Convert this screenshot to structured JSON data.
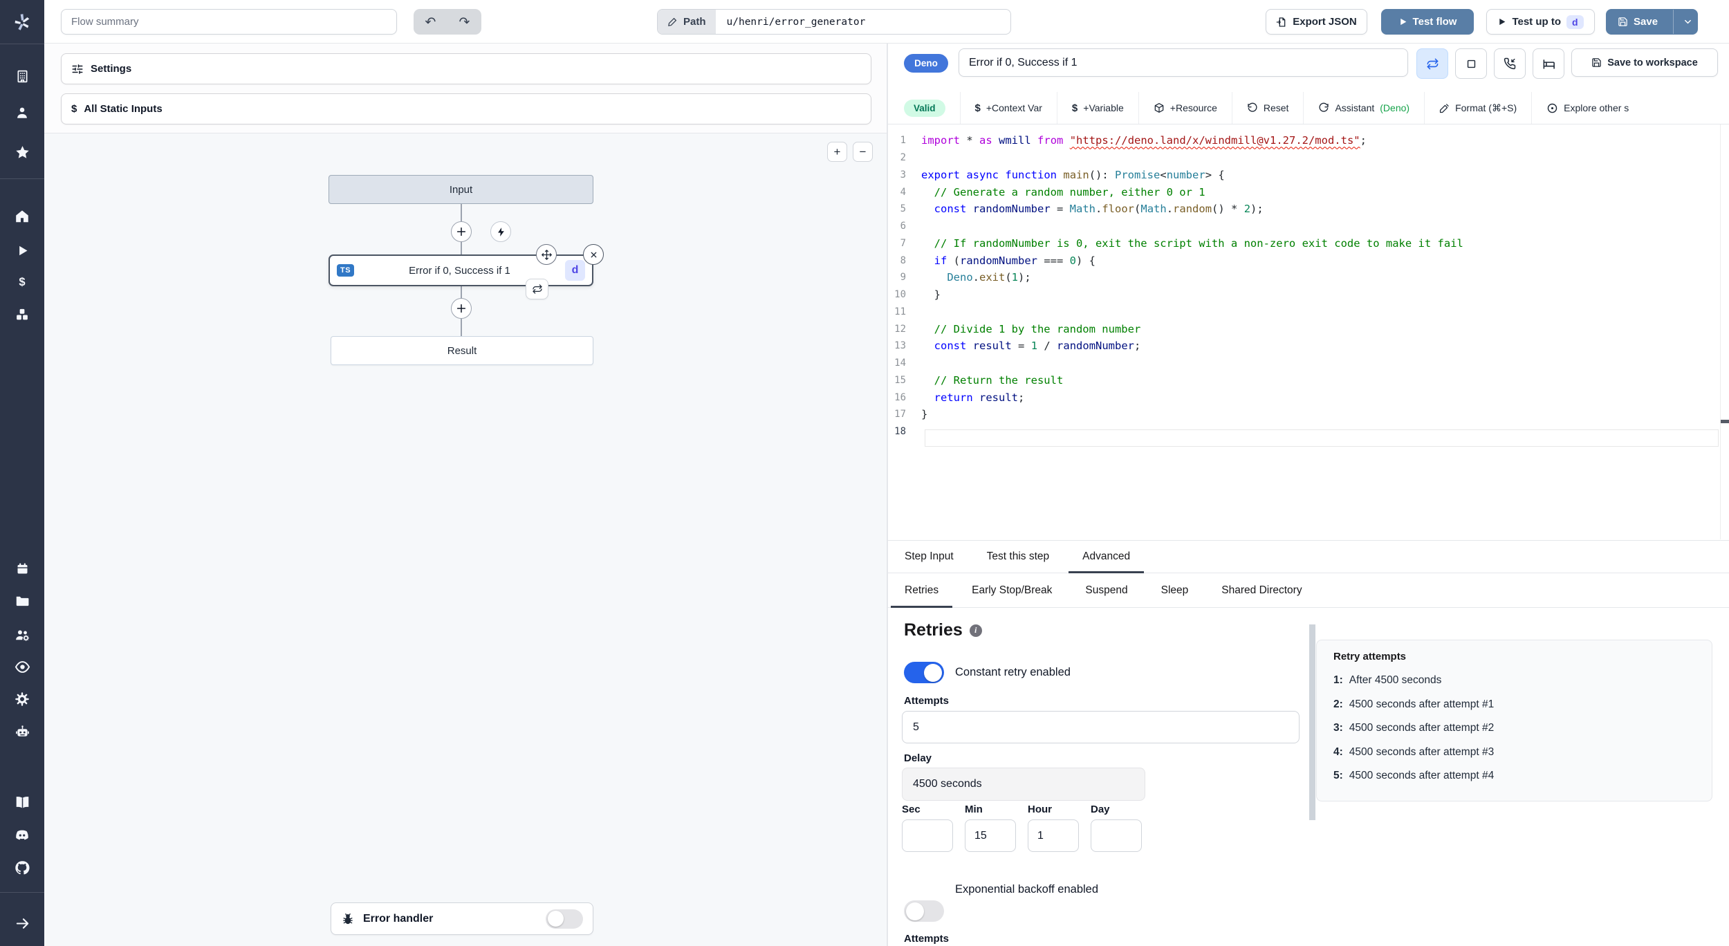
{
  "colors": {
    "sidebar_bg": "#2c3447",
    "primary_button": "#597ea6",
    "toggle_on": "#2563eb",
    "valid_bg": "#d1fae5",
    "valid_text": "#047857",
    "deno_badge": "#4276db",
    "ts_badge": "#3178c6",
    "d_badge_bg": "#e0e7ff",
    "d_badge_text": "#4f46e5",
    "canvas_bg": "#f6f8fa"
  },
  "sidebar": {
    "icons": [
      "windmill-logo",
      "building",
      "user",
      "star",
      "home",
      "play",
      "dollar",
      "cubes",
      "calendar",
      "folder",
      "users-settings",
      "eye",
      "gear",
      "robot",
      "book",
      "discord",
      "github",
      "arrow-right"
    ]
  },
  "topbar": {
    "flow_summary_placeholder": "Flow summary",
    "path_label": "Path",
    "path_value": "u/henri/error_generator",
    "export_json": "Export JSON",
    "test_flow": "Test flow",
    "test_up_to": "Test up to",
    "test_up_to_badge": "d",
    "save": "Save"
  },
  "flow_panel": {
    "settings": "Settings",
    "all_static_inputs": "All Static Inputs",
    "zoom_in": "+",
    "zoom_out": "−",
    "nodes": {
      "input": "Input",
      "module_label": "Error if 0, Success if 1",
      "module_lang_badge": "TS",
      "module_suffix_badge": "d",
      "result": "Result"
    },
    "error_handler": "Error handler"
  },
  "step_panel": {
    "lang_badge": "Deno",
    "step_name": "Error if 0, Success if 1",
    "save_to_workspace": "Save to workspace",
    "toolbar": {
      "valid": "Valid",
      "context_var": "+Context Var",
      "variable": "+Variable",
      "resource": "+Resource",
      "reset": "Reset",
      "assistant": "Assistant",
      "assistant_lang": "(Deno)",
      "format": "Format (⌘+S)",
      "explore": "Explore other s"
    }
  },
  "code": {
    "active_line": 18,
    "lines": [
      [
        [
          "k1",
          "import"
        ],
        [
          "pl",
          " * "
        ],
        [
          "k1",
          "as"
        ],
        [
          "pl",
          " "
        ],
        [
          "id",
          "wmill"
        ],
        [
          "pl",
          " "
        ],
        [
          "k1",
          "from"
        ],
        [
          "pl",
          " "
        ],
        [
          "sq",
          "\"https://deno.land/x/windmill@v1.27.2/mod.ts\""
        ],
        [
          "pl",
          ";"
        ]
      ],
      [],
      [
        [
          "k2",
          "export"
        ],
        [
          "pl",
          " "
        ],
        [
          "k2",
          "async"
        ],
        [
          "pl",
          " "
        ],
        [
          "k2",
          "function"
        ],
        [
          "pl",
          " "
        ],
        [
          "fn",
          "main"
        ],
        [
          "pl",
          "(): "
        ],
        [
          "ty",
          "Promise"
        ],
        [
          "pl",
          "<"
        ],
        [
          "ty",
          "number"
        ],
        [
          "pl",
          "> {"
        ]
      ],
      [
        [
          "co",
          "  // Generate a random number, either 0 or 1"
        ]
      ],
      [
        [
          "pl",
          "  "
        ],
        [
          "k2",
          "const"
        ],
        [
          "pl",
          " "
        ],
        [
          "id",
          "randomNumber"
        ],
        [
          "pl",
          " = "
        ],
        [
          "ty",
          "Math"
        ],
        [
          "pl",
          "."
        ],
        [
          "fn",
          "floor"
        ],
        [
          "pl",
          "("
        ],
        [
          "ty",
          "Math"
        ],
        [
          "pl",
          "."
        ],
        [
          "fn",
          "random"
        ],
        [
          "pl",
          "() * "
        ],
        [
          "nu",
          "2"
        ],
        [
          "pl",
          ");"
        ]
      ],
      [],
      [
        [
          "co",
          "  // If randomNumber is 0, exit the script with a non-zero exit code to make it fail"
        ]
      ],
      [
        [
          "pl",
          "  "
        ],
        [
          "k2",
          "if"
        ],
        [
          "pl",
          " ("
        ],
        [
          "id",
          "randomNumber"
        ],
        [
          "pl",
          " === "
        ],
        [
          "nu",
          "0"
        ],
        [
          "pl",
          ") {"
        ]
      ],
      [
        [
          "pl",
          "    "
        ],
        [
          "ty",
          "Deno"
        ],
        [
          "pl",
          "."
        ],
        [
          "fn",
          "exit"
        ],
        [
          "pl",
          "("
        ],
        [
          "nu",
          "1"
        ],
        [
          "pl",
          ");"
        ]
      ],
      [
        [
          "pl",
          "  }"
        ]
      ],
      [],
      [
        [
          "co",
          "  // Divide 1 by the random number"
        ]
      ],
      [
        [
          "pl",
          "  "
        ],
        [
          "k2",
          "const"
        ],
        [
          "pl",
          " "
        ],
        [
          "id",
          "result"
        ],
        [
          "pl",
          " = "
        ],
        [
          "nu",
          "1"
        ],
        [
          "pl",
          " / "
        ],
        [
          "id",
          "randomNumber"
        ],
        [
          "pl",
          ";"
        ]
      ],
      [],
      [
        [
          "co",
          "  // Return the result"
        ]
      ],
      [
        [
          "pl",
          "  "
        ],
        [
          "k2",
          "return"
        ],
        [
          "pl",
          " "
        ],
        [
          "id",
          "result"
        ],
        [
          "pl",
          ";"
        ]
      ],
      [
        [
          "pl",
          "}"
        ]
      ],
      []
    ]
  },
  "tabs": {
    "main": [
      "Step Input",
      "Test this step",
      "Advanced"
    ],
    "main_active": 2,
    "sub": [
      "Retries",
      "Early Stop/Break",
      "Suspend",
      "Sleep",
      "Shared Directory"
    ],
    "sub_active": 0
  },
  "retries": {
    "title": "Retries",
    "constant_toggle_label": "Constant retry enabled",
    "constant_toggle_on": true,
    "attempts_label": "Attempts",
    "attempts_value": "5",
    "delay_label": "Delay",
    "delay_value": "4500 seconds",
    "time_fields": [
      {
        "label": "Sec",
        "value": ""
      },
      {
        "label": "Min",
        "value": "15"
      },
      {
        "label": "Hour",
        "value": "1"
      },
      {
        "label": "Day",
        "value": ""
      }
    ],
    "exponential_toggle_label": "Exponential backoff enabled",
    "exponential_toggle_on": false,
    "cutoff_label": "Attempts",
    "summary": {
      "title": "Retry attempts",
      "items": [
        {
          "n": "1:",
          "text": "After 4500 seconds"
        },
        {
          "n": "2:",
          "text": "4500 seconds after attempt #1"
        },
        {
          "n": "3:",
          "text": "4500 seconds after attempt #2"
        },
        {
          "n": "4:",
          "text": "4500 seconds after attempt #3"
        },
        {
          "n": "5:",
          "text": "4500 seconds after attempt #4"
        }
      ]
    }
  }
}
